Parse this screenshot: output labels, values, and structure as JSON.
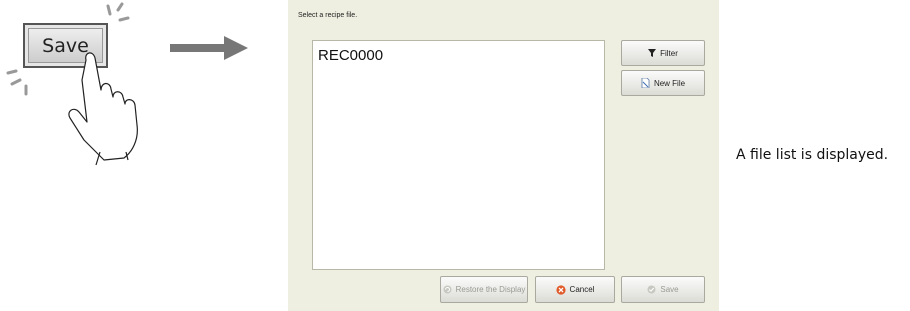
{
  "illustration": {
    "save_button_label": "Save"
  },
  "dialog": {
    "prompt": "Select a recipe file.",
    "files": [
      "REC0000"
    ],
    "buttons": {
      "filter": "Filter",
      "new_file": "New File",
      "restore": "Restore the Display",
      "cancel": "Cancel",
      "save": "Save"
    },
    "colors": {
      "panel_background": "#efefe1",
      "cancel_icon": "#e05a2a",
      "disabled_text": "#9a9a94"
    }
  },
  "caption": "A file list is displayed."
}
